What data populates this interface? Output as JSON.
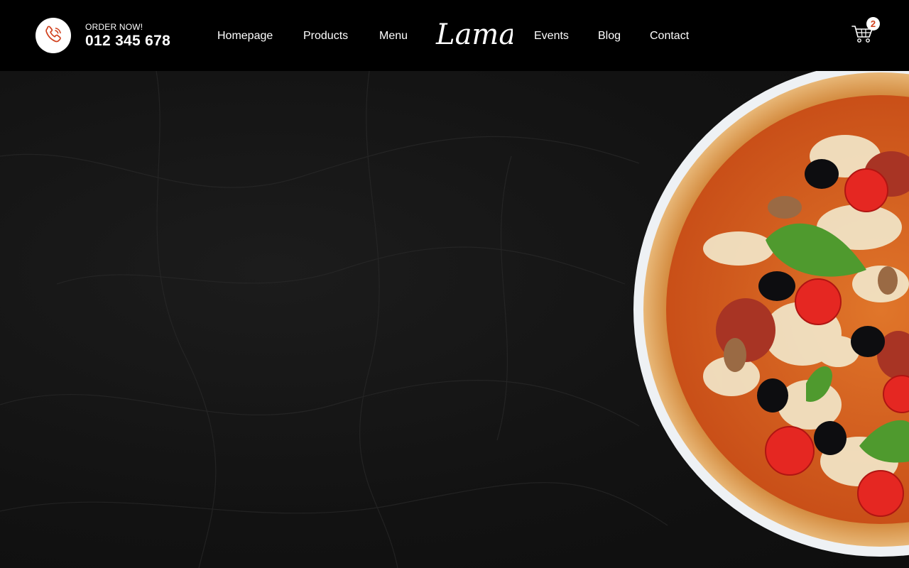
{
  "navbar": {
    "order_label": "ORDER NOW!",
    "order_phone": "012 345 678",
    "links": [
      {
        "label": "Homepage"
      },
      {
        "label": "Products"
      },
      {
        "label": "Menu"
      },
      {
        "label": "Events"
      },
      {
        "label": "Blog"
      },
      {
        "label": "Contact"
      }
    ],
    "logo_text": "Lama",
    "cart_count": "2",
    "icons": {
      "phone": "phone-icon",
      "cart": "cart-icon"
    }
  },
  "colors": {
    "navbar_bg": "#000000",
    "hero_bg": "#141414",
    "accent": "#d1411e",
    "text": "#ffffff"
  }
}
